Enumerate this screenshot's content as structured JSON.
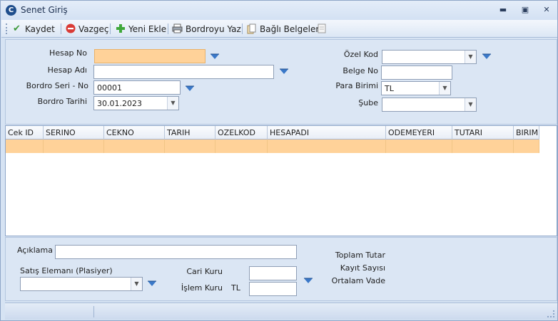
{
  "window": {
    "title": "Senet Giriş"
  },
  "toolbar": {
    "save_label": "Kaydet",
    "cancel_label": "Vazgeç",
    "new_label": "Yeni Ekle",
    "print_label": "Bordroyu Yaz",
    "linked_docs_label": "Bağlı Belgeler"
  },
  "header_form": {
    "hesap_no_label": "Hesap No",
    "hesap_no_value": "",
    "hesap_adi_label": "Hesap Adı",
    "hesap_adi_value": "",
    "bordro_seri_label": "Bordro Seri - No",
    "bordro_seri_value": "00001",
    "bordro_tarihi_label": "Bordro Tarihi",
    "bordro_tarihi_value": "30.01.2023",
    "ozel_kod_label": "Özel Kod",
    "ozel_kod_value": "",
    "belge_no_label": "Belge No",
    "belge_no_value": "",
    "para_birimi_label": "Para Birimi",
    "para_birimi_value": "TL",
    "sube_label": "Şube",
    "sube_value": ""
  },
  "grid": {
    "columns": [
      "Cek ID",
      "SERINO",
      "CEKNO",
      "TARIH",
      "OZELKOD",
      "HESAPADI",
      "ODEMEYERI",
      "TUTARI",
      "BIRIM"
    ]
  },
  "footer_form": {
    "aciklama_label": "Açıklama",
    "aciklama_value": "",
    "satis_elemani_label": "Satış Elemanı (Plasiyer)",
    "satis_elemani_value": "",
    "cari_kuru_label": "Cari Kuru",
    "cari_kuru_value": "",
    "islem_kuru_label": "İşlem Kuru",
    "islem_kuru_currency": "TL",
    "islem_kuru_value": "",
    "toplam_tutar_label": "Toplam Tutar",
    "kayit_sayisi_label": "Kayıt Sayısı",
    "ortalam_vade_label": "Ortalam Vade"
  },
  "colors": {
    "focus_field": "#ffd299",
    "panel_bg": "#dbe6f4",
    "accent": "#1f4e8c",
    "dropdown_icon": "#3a78c8"
  },
  "icons": [
    "app-logo-icon",
    "checkmark-icon",
    "cancel-icon",
    "plus-icon",
    "printer-icon",
    "documents-icon",
    "page-icon",
    "filter-dropdown-icon",
    "chevron-down-icon",
    "minimize-icon",
    "restore-icon",
    "close-icon"
  ]
}
